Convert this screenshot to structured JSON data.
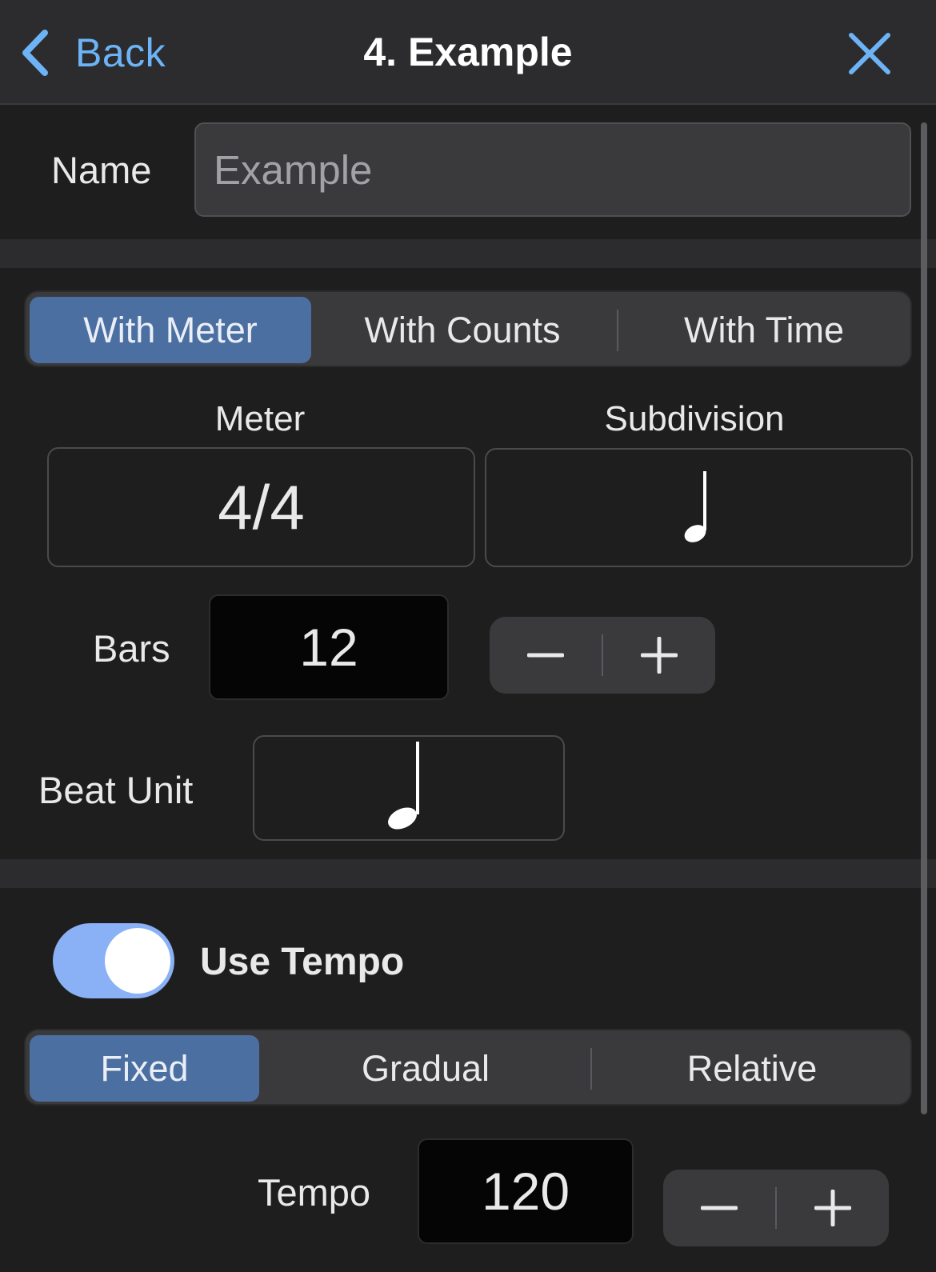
{
  "header": {
    "back_label": "Back",
    "title": "4. Example",
    "back_icon": "chevron-left-icon",
    "close_icon": "close-x-icon",
    "accent_color": "#6cb4f5"
  },
  "name_row": {
    "label": "Name",
    "value": "Example"
  },
  "mode_tabs": {
    "items": [
      "With Meter",
      "With Counts",
      "With Time"
    ],
    "selected": "With Meter"
  },
  "meter": {
    "label": "Meter",
    "value": "4/4"
  },
  "subdivision": {
    "label": "Subdivision",
    "icon": "quarter-note-icon"
  },
  "bars": {
    "label": "Bars",
    "value": "12",
    "decrement": "−",
    "increment": "+"
  },
  "beat_unit": {
    "label": "Beat Unit",
    "icon": "half-note-icon"
  },
  "use_tempo": {
    "label": "Use Tempo",
    "on": true,
    "toggle_color": "#8ab0f5"
  },
  "tempo_tabs": {
    "items": [
      "Fixed",
      "Gradual",
      "Relative"
    ],
    "selected": "Fixed"
  },
  "tempo": {
    "label": "Tempo",
    "value": "120",
    "decrement": "−",
    "increment": "+"
  },
  "colors": {
    "selected_segment": "#4b6fa0",
    "background": "#1e1e1e"
  }
}
